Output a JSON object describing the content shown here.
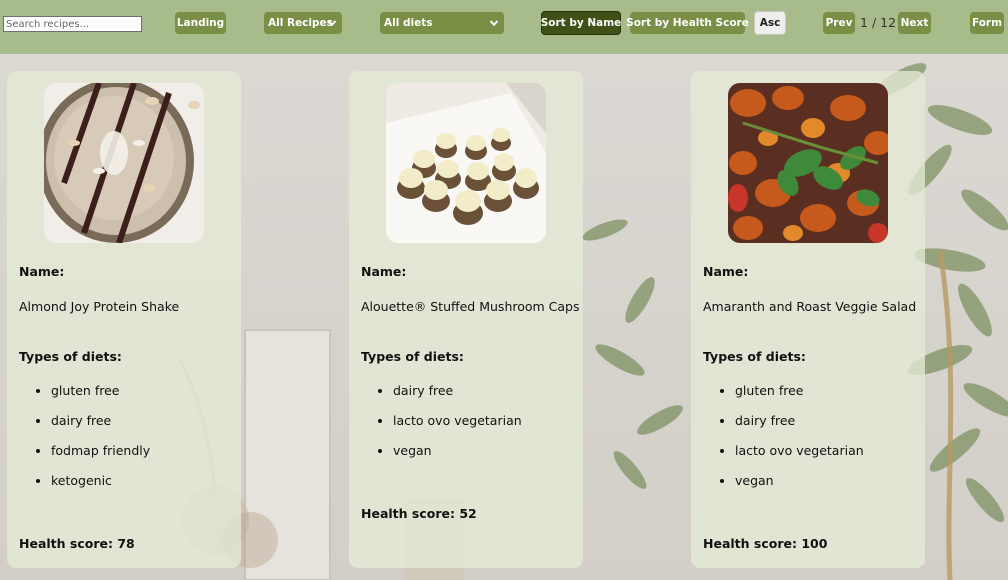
{
  "toolbar": {
    "search_placeholder": "Search recipes...",
    "landing_label": "Landing",
    "filter_recipes": "All Recipes",
    "filter_diets": "All diets",
    "sort_name_label": "Sort by Name",
    "sort_health_label": "Sort by Health Score",
    "order_label": "Asc",
    "prev_label": "Prev",
    "page_current": "1",
    "page_separator": "/",
    "page_total": "12",
    "next_label": "Next",
    "form_label": "Form"
  },
  "labels": {
    "name": "Name:",
    "diets": "Types of diets:",
    "health_score": "Health score:"
  },
  "recipes": [
    {
      "name": "Almond Joy Protein Shake",
      "image_icon": "protein-shake-photo",
      "diets": [
        "gluten free",
        "dairy free",
        "fodmap friendly",
        "ketogenic"
      ],
      "health_score": "78"
    },
    {
      "name": "Alouette® Stuffed Mushroom Caps",
      "image_icon": "stuffed-mushrooms-photo",
      "diets": [
        "dairy free",
        "lacto ovo vegetarian",
        "vegan"
      ],
      "health_score": "52"
    },
    {
      "name": "Amaranth and Roast Veggie Salad",
      "image_icon": "veggie-salad-photo",
      "diets": [
        "gluten free",
        "dairy free",
        "lacto ovo vegetarian",
        "vegan"
      ],
      "health_score": "100"
    }
  ],
  "colors": {
    "topbar": "#a8bb8a",
    "button": "#7a8f46",
    "button_active": "#3f5117",
    "card": "#e6ead6"
  }
}
